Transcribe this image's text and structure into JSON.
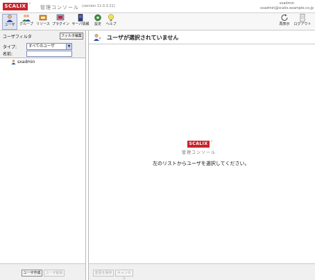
{
  "header": {
    "logo_text": "SCALIX",
    "logo_tm": "™",
    "app_title": "管理コンソール",
    "version": "(version 11.0.3.21)",
    "user_name": "sxadmin",
    "user_email": "sxadmin@scalix.example.co.jp"
  },
  "toolbar": {
    "items": [
      {
        "label": "ユーザ",
        "icon": "user-icon",
        "active": true
      },
      {
        "label": "グループ",
        "icon": "group-icon"
      },
      {
        "label": "リソース",
        "icon": "resource-icon"
      },
      {
        "label": "プラグイン",
        "icon": "plugin-icon"
      },
      {
        "label": "サーバ情報",
        "icon": "server-info-icon"
      },
      {
        "label": "設定",
        "icon": "settings-icon"
      },
      {
        "label": "ヘルプ",
        "icon": "help-icon"
      }
    ],
    "refresh_label": "再表示",
    "logout_label": "ログアウト"
  },
  "left": {
    "filter_title": "ユーザフィルタ",
    "filter_edit_label": "フィルタ編集",
    "type_label": "タイプ:",
    "type_value": "すべてのユーザ",
    "name_label": "名前:",
    "name_value": "",
    "users": [
      "sxadmin"
    ],
    "create_label": "ユーザ作成",
    "delete_label": "ユーザ削除"
  },
  "right": {
    "title": "ユーザが選択されていません",
    "logo_text": "SCALIX",
    "logo_tm": "™",
    "subtitle": "管理コンソール",
    "message": "左のリストからユーザを選択してください。",
    "save_label": "変更を保存",
    "cancel_label": "キャンセル"
  },
  "colors": {
    "brand": "#c8242b",
    "panel_bg": "#f0f0f0",
    "select_border": "#7a8ab8"
  }
}
